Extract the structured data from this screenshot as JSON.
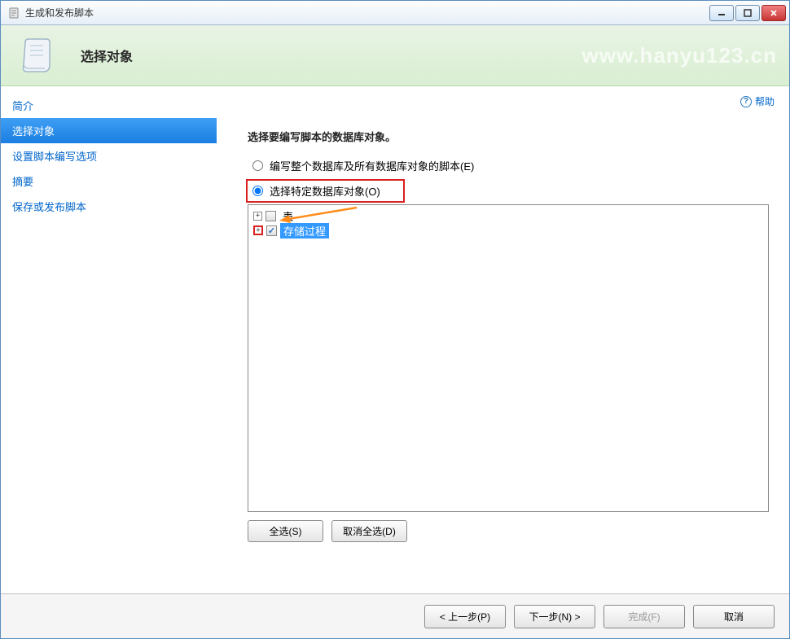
{
  "window": {
    "title": "生成和发布脚本"
  },
  "header": {
    "title": "选择对象",
    "watermark": "www.hanyu123.cn"
  },
  "sidebar": {
    "items": [
      {
        "label": "简介",
        "active": false
      },
      {
        "label": "选择对象",
        "active": true
      },
      {
        "label": "设置脚本编写选项",
        "active": false
      },
      {
        "label": "摘要",
        "active": false
      },
      {
        "label": "保存或发布脚本",
        "active": false
      }
    ]
  },
  "main": {
    "help_label": "帮助",
    "prompt": "选择要编写脚本的数据库对象。",
    "radio_all": "编写整个数据库及所有数据库对象的脚本(E)",
    "radio_specific": "选择特定数据库对象(O)",
    "tree": {
      "items": [
        {
          "label": "表",
          "checked": false,
          "highlight_expander": false
        },
        {
          "label": "存储过程",
          "checked": true,
          "highlight_expander": true,
          "selected": true
        }
      ]
    },
    "select_all": "全选(S)",
    "deselect_all": "取消全选(D)"
  },
  "footer": {
    "prev": "< 上一步(P)",
    "next": "下一步(N) >",
    "finish": "完成(F)",
    "cancel": "取消"
  }
}
